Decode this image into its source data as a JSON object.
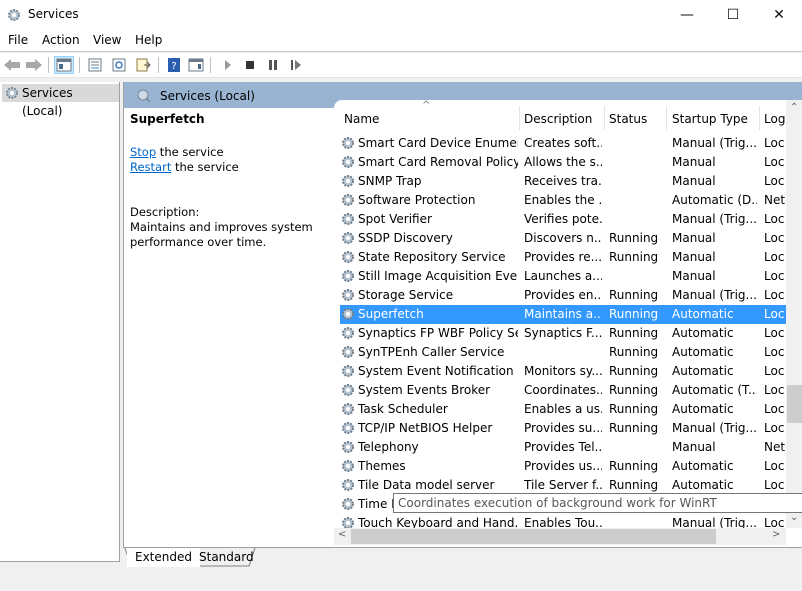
{
  "window": {
    "title": "Services",
    "controls": {
      "minimize": "—",
      "maximize": "☐",
      "close": "✕"
    }
  },
  "menu": [
    "File",
    "Action",
    "View",
    "Help"
  ],
  "toolbar": {
    "buttons": [
      "back-icon",
      "forward-icon",
      "show-hide-console-tree-icon",
      "properties-icon",
      "refresh-icon",
      "export-list-icon",
      "help-icon",
      "action-pane-icon",
      "start-icon",
      "stop-icon",
      "pause-icon",
      "resume-icon"
    ]
  },
  "tree": {
    "selected": "Services (Local)"
  },
  "pane": {
    "header": "Services (Local)",
    "selected_name": "Superfetch",
    "stop_link": "Stop",
    "stop_rest": " the service",
    "restart_link": "Restart",
    "restart_rest": " the service",
    "description_label": "Description:",
    "description": "Maintains and improves system performance over time."
  },
  "columns": [
    "Name",
    "Description",
    "Status",
    "Startup Type",
    "Log"
  ],
  "services": [
    {
      "name": "Smart Card Device Enumera...",
      "description": "Creates soft...",
      "status": "",
      "startup": "Manual (Trig...",
      "logon": "Loc"
    },
    {
      "name": "Smart Card Removal Policy",
      "description": "Allows the s...",
      "status": "",
      "startup": "Manual",
      "logon": "Loc"
    },
    {
      "name": "SNMP Trap",
      "description": "Receives tra...",
      "status": "",
      "startup": "Manual",
      "logon": "Loc"
    },
    {
      "name": "Software Protection",
      "description": "Enables the ...",
      "status": "",
      "startup": "Automatic (D...",
      "logon": "Net"
    },
    {
      "name": "Spot Verifier",
      "description": "Verifies pote...",
      "status": "",
      "startup": "Manual (Trig...",
      "logon": "Loc"
    },
    {
      "name": "SSDP Discovery",
      "description": "Discovers n...",
      "status": "Running",
      "startup": "Manual",
      "logon": "Loc"
    },
    {
      "name": "State Repository Service",
      "description": "Provides re...",
      "status": "Running",
      "startup": "Manual",
      "logon": "Loc"
    },
    {
      "name": "Still Image Acquisition Events",
      "description": "Launches a...",
      "status": "",
      "startup": "Manual",
      "logon": "Loc"
    },
    {
      "name": "Storage Service",
      "description": "Provides en...",
      "status": "Running",
      "startup": "Manual (Trig...",
      "logon": "Loc"
    },
    {
      "name": "Superfetch",
      "description": "Maintains a...",
      "status": "Running",
      "startup": "Automatic",
      "logon": "Loc",
      "selected": true
    },
    {
      "name": "Synaptics FP WBF Policy Ser...",
      "description": "Synaptics F...",
      "status": "Running",
      "startup": "Automatic",
      "logon": "Loc"
    },
    {
      "name": "SynTPEnh Caller Service",
      "description": "",
      "status": "Running",
      "startup": "Automatic",
      "logon": "Loc"
    },
    {
      "name": "System Event Notification S...",
      "description": "Monitors sy...",
      "status": "Running",
      "startup": "Automatic",
      "logon": "Loc"
    },
    {
      "name": "System Events Broker",
      "description": "Coordinates...",
      "status": "Running",
      "startup": "Automatic (T...",
      "logon": "Loc"
    },
    {
      "name": "Task Scheduler",
      "description": "Enables a us...",
      "status": "Running",
      "startup": "Automatic",
      "logon": "Loc"
    },
    {
      "name": "TCP/IP NetBIOS Helper",
      "description": "Provides su...",
      "status": "Running",
      "startup": "Manual (Trig...",
      "logon": "Loc"
    },
    {
      "name": "Telephony",
      "description": "Provides Tel...",
      "status": "",
      "startup": "Manual",
      "logon": "Net"
    },
    {
      "name": "Themes",
      "description": "Provides us...",
      "status": "Running",
      "startup": "Automatic",
      "logon": "Loc"
    },
    {
      "name": "Tile Data model server",
      "description": "Tile Server f...",
      "status": "Running",
      "startup": "Automatic",
      "logon": "Loc"
    },
    {
      "name": "Time Broker",
      "description": "",
      "status": "",
      "startup": "",
      "logon": ""
    },
    {
      "name": "Touch Keyboard and Hand...",
      "description": "Enables Tou...",
      "status": "",
      "startup": "Manual (Trig...",
      "logon": "Loc"
    }
  ],
  "tooltip": "Coordinates execution of background work for WinRT",
  "tabs": [
    "Extended",
    "Standard"
  ],
  "active_tab": "Extended",
  "colors": {
    "selection": "#3399ff",
    "header": "#99b4d1",
    "link": "#0066cc"
  }
}
